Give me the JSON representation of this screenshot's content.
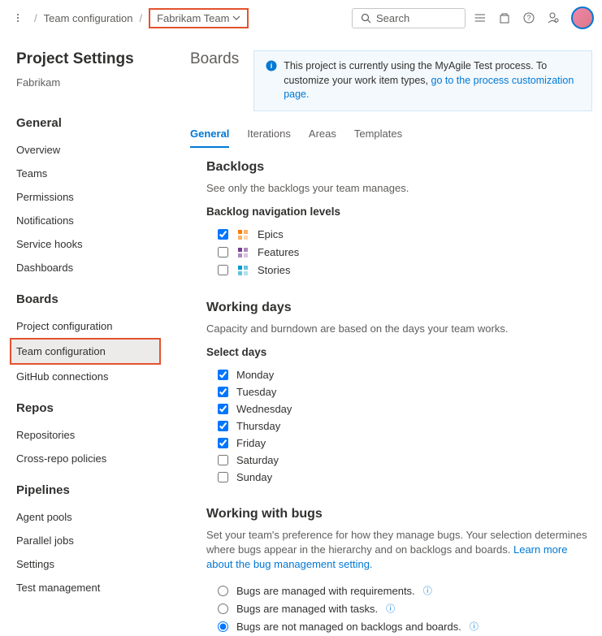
{
  "topbar": {
    "breadcrumb1": "Team configuration",
    "team_name": "Fabrikam Team",
    "search_placeholder": "Search"
  },
  "sidebar": {
    "title": "Project Settings",
    "project_name": "Fabrikam",
    "sections": {
      "general": {
        "header": "General",
        "items": [
          "Overview",
          "Teams",
          "Permissions",
          "Notifications",
          "Service hooks",
          "Dashboards"
        ]
      },
      "boards": {
        "header": "Boards",
        "items": [
          "Project configuration",
          "Team configuration",
          "GitHub connections"
        ]
      },
      "repos": {
        "header": "Repos",
        "items": [
          "Repositories",
          "Cross-repo policies"
        ]
      },
      "pipelines": {
        "header": "Pipelines",
        "items": [
          "Agent pools",
          "Parallel jobs",
          "Settings",
          "Test management"
        ]
      }
    }
  },
  "main": {
    "title": "Boards",
    "banner": {
      "text_pre": "This project is currently using the MyAgile Test process. To customize your work item types, ",
      "link": "go to the process customization page."
    },
    "tabs": [
      "General",
      "Iterations",
      "Areas",
      "Templates"
    ],
    "backlogs": {
      "heading": "Backlogs",
      "desc": "See only the backlogs your team manages.",
      "sub": "Backlog navigation levels",
      "levels": [
        {
          "label": "Epics",
          "checked": true,
          "color": "#ff7b00"
        },
        {
          "label": "Features",
          "checked": false,
          "color": "#773b93"
        },
        {
          "label": "Stories",
          "checked": false,
          "color": "#009ccc"
        }
      ]
    },
    "working_days": {
      "heading": "Working days",
      "desc": "Capacity and burndown are based on the days your team works.",
      "sub": "Select days",
      "days": [
        {
          "label": "Monday",
          "checked": true
        },
        {
          "label": "Tuesday",
          "checked": true
        },
        {
          "label": "Wednesday",
          "checked": true
        },
        {
          "label": "Thursday",
          "checked": true
        },
        {
          "label": "Friday",
          "checked": true
        },
        {
          "label": "Saturday",
          "checked": false
        },
        {
          "label": "Sunday",
          "checked": false
        }
      ]
    },
    "bugs": {
      "heading": "Working with bugs",
      "desc_pre": "Set your team's preference for how they manage bugs. Your selection determines where bugs appear in the hierarchy and on backlogs and boards. ",
      "link": "Learn more about the bug management setting.",
      "options": [
        {
          "label": "Bugs are managed with requirements.",
          "checked": false
        },
        {
          "label": "Bugs are managed with tasks.",
          "checked": false
        },
        {
          "label": "Bugs are not managed on backlogs and boards.",
          "checked": true
        }
      ]
    }
  }
}
